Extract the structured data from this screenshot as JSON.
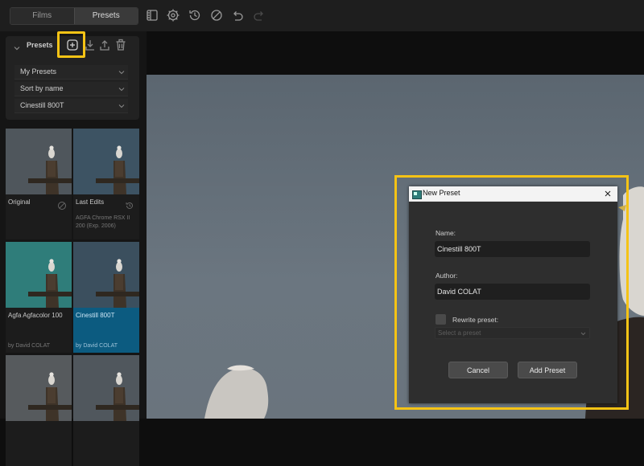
{
  "toolbar": {
    "tabs": [
      {
        "label": "Films",
        "active": false
      },
      {
        "label": "Presets",
        "active": true
      }
    ],
    "icons": [
      "layout-icon",
      "settings-icon",
      "history-icon",
      "disable-icon",
      "undo-icon",
      "redo-icon"
    ]
  },
  "presets_panel": {
    "title": "Presets",
    "actions": [
      "add-preset-icon",
      "download-icon",
      "upload-icon",
      "trash-icon"
    ],
    "dropdowns": [
      {
        "value": "My Presets"
      },
      {
        "value": "Sort by name"
      },
      {
        "value": "Cinestill 800T"
      }
    ]
  },
  "thumbnails": [
    {
      "name": "Original",
      "sub": "",
      "icon": "disable-icon",
      "tint": "#4f565c"
    },
    {
      "name": "Last Edits",
      "sub": "AGFA Chrome RSX II 200 (Exp. 2006)",
      "icon": "history-icon",
      "tint": "#3d5363"
    },
    {
      "name": "Agfa Agfacolor 100",
      "sub": "by David COLAT",
      "tint": "#2f7d7a"
    },
    {
      "name": "Cinestill 800T",
      "sub": "by David COLAT",
      "tint": "#3b4f5e",
      "selected": true
    },
    {
      "name": "",
      "sub": "",
      "tint": "#565a5d"
    },
    {
      "name": "",
      "sub": "",
      "tint": "#50575d"
    }
  ],
  "dialog": {
    "title": "New Preset",
    "name_label": "Name:",
    "name_value": "Cinestill 800T",
    "author_label": "Author:",
    "author_value": "David COLAT",
    "rewrite_label": "Rewrite preset:",
    "rewrite_checked": false,
    "select_placeholder": "Select a preset",
    "cancel_label": "Cancel",
    "add_label": "Add Preset"
  },
  "colors": {
    "highlight": "#f5c315",
    "selection": "#0c5b80"
  }
}
